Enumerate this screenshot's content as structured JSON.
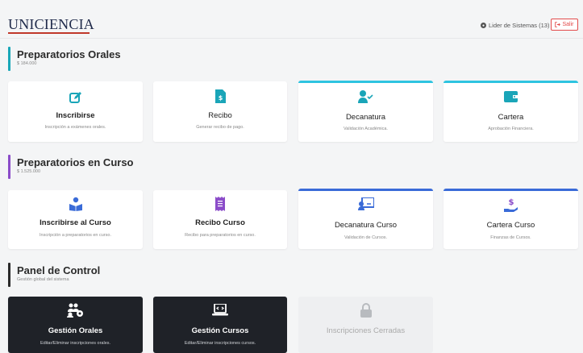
{
  "header": {
    "brand": "UNICIENCIA",
    "user_label": "Lider de Sistemas (13)",
    "logout_label": "Salir"
  },
  "sections": [
    {
      "title": "Preparatorios Orales",
      "subtitle": "$ 184.000",
      "color": "#19a7b8",
      "cards": [
        {
          "title": "Inscribirse",
          "desc": "Inscripción a exámenes orales.",
          "icon": "edit-icon"
        },
        {
          "title": "Recibo",
          "desc": "Generar recibo de pago.",
          "icon": "invoice-icon"
        },
        {
          "title": "Decanatura",
          "desc": "Validación Académica.",
          "icon": "user-check-icon"
        },
        {
          "title": "Cartera",
          "desc": "Aprobación Financiera.",
          "icon": "wallet-icon"
        }
      ]
    },
    {
      "title": "Preparatorios en Curso",
      "subtitle": "$ 1.525.000",
      "color": "#8b4cc9",
      "cards": [
        {
          "title": "Inscribirse al Curso",
          "desc": "Inscripción a preparatorios en curso.",
          "icon": "reader-icon"
        },
        {
          "title": "Recibo Curso",
          "desc": "Recibo para preparatorios en curso.",
          "icon": "receipt-icon"
        },
        {
          "title": "Decanatura Curso",
          "desc": "Validación de Cursos.",
          "icon": "teacher-icon"
        },
        {
          "title": "Cartera Curso",
          "desc": "Finanzas de Cursos.",
          "icon": "hand-dollar-icon"
        }
      ]
    },
    {
      "title": "Panel de Control",
      "subtitle": "Gestión global del sistema",
      "color": "#2b2b2b",
      "cards": [
        {
          "title": "Gestión Orales",
          "desc": "Editar/Eliminar inscripciones orales.",
          "icon": "users-cog-icon"
        },
        {
          "title": "Gestión Cursos",
          "desc": "Editar/Eliminar inscripciones cursos.",
          "icon": "laptop-code-icon"
        },
        {
          "title": "Inscripciones Cerradas",
          "desc": "",
          "icon": "lock-icon"
        }
      ]
    }
  ]
}
